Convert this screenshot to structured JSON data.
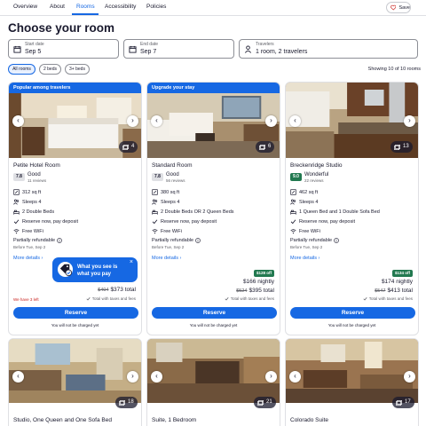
{
  "tabs": [
    {
      "label": "Overview"
    },
    {
      "label": "About"
    },
    {
      "label": "Rooms"
    },
    {
      "label": "Accessibility"
    },
    {
      "label": "Policies"
    }
  ],
  "active_tab": "Rooms",
  "save_label": "Save",
  "page_title": "Choose your room",
  "search": {
    "start_label": "Start date",
    "start_value": "Sep 5",
    "end_label": "End date",
    "end_value": "Sep 7",
    "travelers_label": "Travelers",
    "travelers_value": "1 room, 2 travelers"
  },
  "filters": [
    {
      "label": "All rooms",
      "selected": true
    },
    {
      "label": "2 beds",
      "selected": false
    },
    {
      "label": "3+ beds",
      "selected": false
    }
  ],
  "showing_text": "Showing 10 of 10 rooms",
  "colors": {
    "accent": "#1668e3",
    "deal_green": "#227950",
    "urgent_red": "#c9221e"
  },
  "tooltip": {
    "text": "What you see is what you pay",
    "close": "×"
  },
  "rooms": [
    {
      "banner": "Popular among travelers",
      "photo_count": "4",
      "name": "Petite Hotel Room",
      "score": "7.8",
      "rating_word": "Good",
      "reviews": "11 reviews",
      "amenities": [
        {
          "icon": "area-icon",
          "text": "312 sq ft"
        },
        {
          "icon": "people-icon",
          "text": "Sleeps 4"
        },
        {
          "icon": "bed-icon",
          "text": "2 Double Beds"
        },
        {
          "icon": "check-icon",
          "text": "Reserve now, pay deposit"
        },
        {
          "icon": "wifi-icon",
          "text": "Free WiFi"
        }
      ],
      "refund": "Partially refundable",
      "refund_sub": "Before Tue, Sep 2",
      "more": "More details",
      "deal": "",
      "nightly": "",
      "old_total": "$404",
      "total": "$373 total",
      "taxes": "Total with taxes and fees",
      "left_note": "We have 3 left",
      "reserve": "Reserve",
      "no_charge": "You will not be charged yet"
    },
    {
      "banner": "Upgrade your stay",
      "photo_count": "6",
      "name": "Standard Room",
      "score": "7.8",
      "rating_word": "Good",
      "reviews": "56 reviews",
      "amenities": [
        {
          "icon": "area-icon",
          "text": "380 sq ft"
        },
        {
          "icon": "people-icon",
          "text": "Sleeps 4"
        },
        {
          "icon": "bed-icon",
          "text": "2 Double Beds OR 2 Queen Beds"
        },
        {
          "icon": "check-icon",
          "text": "Reserve now, pay deposit"
        },
        {
          "icon": "wifi-icon",
          "text": "Free WiFi"
        }
      ],
      "refund": "Partially refundable",
      "refund_sub": "Before Tue, Sep 2",
      "more": "More details",
      "deal": "$128 off",
      "nightly": "$166 nightly",
      "old_total": "$524",
      "total": "$395 total",
      "taxes": "Total with taxes and fees",
      "left_note": "",
      "reserve": "Reserve",
      "no_charge": "You will not be charged yet"
    },
    {
      "banner": "",
      "photo_count": "13",
      "name": "Breckenridge Studio",
      "score": "9.0",
      "rating_word": "Wonderful",
      "reviews": "22 reviews",
      "amenities": [
        {
          "icon": "area-icon",
          "text": "462 sq ft"
        },
        {
          "icon": "people-icon",
          "text": "Sleeps 4"
        },
        {
          "icon": "bed-icon",
          "text": "1 Queen Bed and 1 Double Sofa Bed"
        },
        {
          "icon": "check-icon",
          "text": "Reserve now, pay deposit"
        },
        {
          "icon": "wifi-icon",
          "text": "Free WiFi"
        }
      ],
      "refund": "Partially refundable",
      "refund_sub": "Before Tue, Sep 2",
      "more": "More details",
      "deal": "$134 off",
      "nightly": "$174 nightly",
      "old_total": "$547",
      "total": "$413 total",
      "taxes": "Total with taxes and fees",
      "left_note": "",
      "reserve": "Reserve",
      "no_charge": "You will not be charged yet"
    },
    {
      "photo_count": "18",
      "name": "Studio, One Queen and One Sofa Bed"
    },
    {
      "photo_count": "21",
      "name": "Suite, 1 Bedroom"
    },
    {
      "photo_count": "17",
      "name": "Colorado Suite"
    }
  ]
}
